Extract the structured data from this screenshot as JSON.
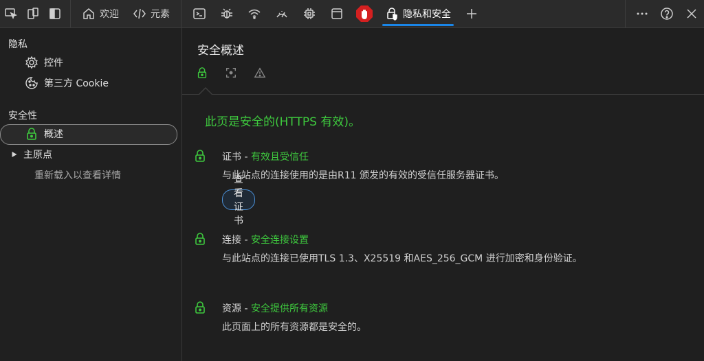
{
  "toolbar": {
    "tabs": [
      {
        "label": "欢迎"
      },
      {
        "label": "元素"
      },
      {
        "label": "隐私和安全"
      }
    ]
  },
  "sidebar": {
    "privacy_heading": "隐私",
    "controls_label": "控件",
    "cookie_label": "第三方 Cookie",
    "security_heading": "安全性",
    "overview_label": "概述",
    "origin_label": "主原点",
    "reload_hint": "重新载入以查看详情"
  },
  "main": {
    "title": "安全概述",
    "headline": "此页是安全的(HTTPS 有效)。",
    "sections": [
      {
        "label": "证书",
        "state": "有效且受信任",
        "desc": "与此站点的连接使用的是由R11 颁发的有效的受信任服务器证书。",
        "button": "查看证书"
      },
      {
        "label": "连接",
        "state": "安全连接设置",
        "desc": "与此站点的连接已使用TLS 1.3、X25519 和AES_256_GCM 进行加密和身份验证。"
      },
      {
        "label": "资源",
        "state": "安全提供所有资源",
        "desc": "此页面上的所有资源都是安全的。"
      }
    ]
  },
  "colors": {
    "secure_green": "#3ec93e",
    "accent_blue": "#1a86e8"
  }
}
